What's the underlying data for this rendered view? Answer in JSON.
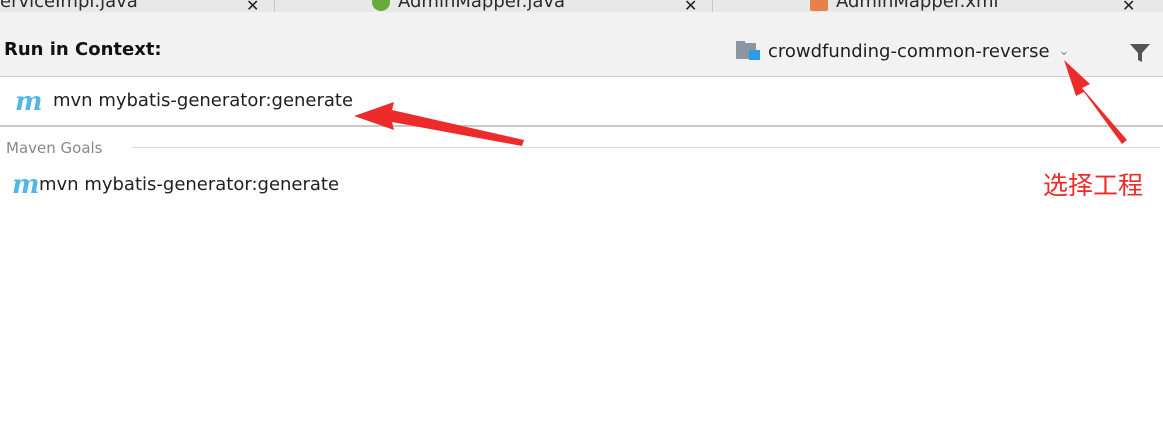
{
  "tabs": [
    {
      "label": "erviceImpl.java"
    },
    {
      "label": "AdminMapper.java"
    },
    {
      "label": "AdminMapper.xml"
    }
  ],
  "header": {
    "title": "Run in Context:",
    "context_selector": "crowdfunding-common-reverse"
  },
  "search": {
    "value": "mvn mybatis-generator:generate"
  },
  "goals": {
    "section_label": "Maven Goals",
    "items": [
      {
        "label": "mvn mybatis-generator:generate"
      }
    ]
  },
  "annotation": {
    "note": "选择工程",
    "color": "#ee2b2b"
  },
  "colors": {
    "maven_icon": "#53b6e8",
    "header_bg": "#f2f2f2"
  },
  "icons": [
    "maven-icon",
    "folder-icon",
    "chevron-down-icon",
    "filter-icon",
    "java-class-icon",
    "xml-file-icon",
    "arrow-annotation"
  ]
}
